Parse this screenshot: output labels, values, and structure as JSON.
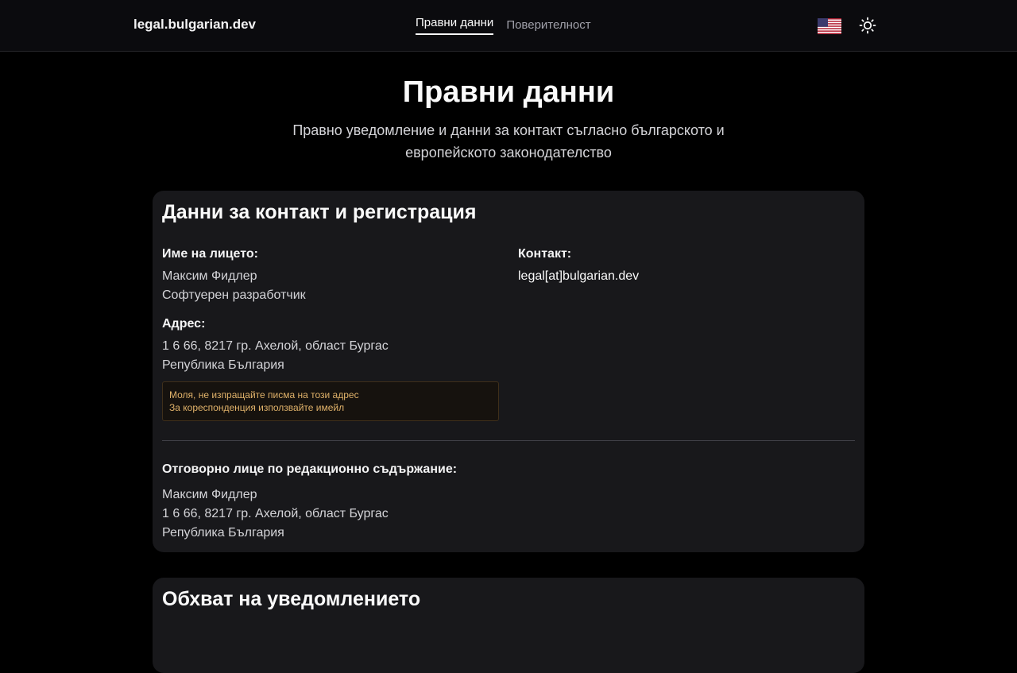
{
  "header": {
    "brand": "legal.bulgarian.dev",
    "nav": [
      {
        "label": "Правни данни",
        "active": true
      },
      {
        "label": "Поверителност",
        "active": false
      }
    ],
    "language_icon": "us-flag-icon",
    "theme_icon": "sun-icon"
  },
  "hero": {
    "title": "Правни данни",
    "subtitle": "Правно уведомление и данни за контакт съгласно българското и европейското законодателство"
  },
  "contact_card": {
    "title": "Данни за контакт и регистрация",
    "name_label": "Име на лицето:",
    "name": "Максим Фидлер",
    "role": "Софтуерен разработчик",
    "contact_label": "Контакт:",
    "email": "legal[at]bulgarian.dev",
    "address_label": "Адрес:",
    "address_line1": "1 6 66, 8217 гр. Ахелой, област Бургас",
    "address_line2": "Република България",
    "notice_line1": "Моля, не изпращайте писма на този адрес",
    "notice_line2": "За кореспонденция използвайте имейл",
    "editorial_label": "Отговорно лице по редакционно съдържание:",
    "editorial_name": "Максим Фидлер",
    "editorial_address1": "1 6 66, 8217 гр. Ахелой, област Бургас",
    "editorial_address2": "Република България"
  },
  "scope_card": {
    "title": "Обхват на уведомлението"
  },
  "colors": {
    "background": "#000000",
    "card": "#18181b",
    "notice_text": "#e0b26a"
  }
}
